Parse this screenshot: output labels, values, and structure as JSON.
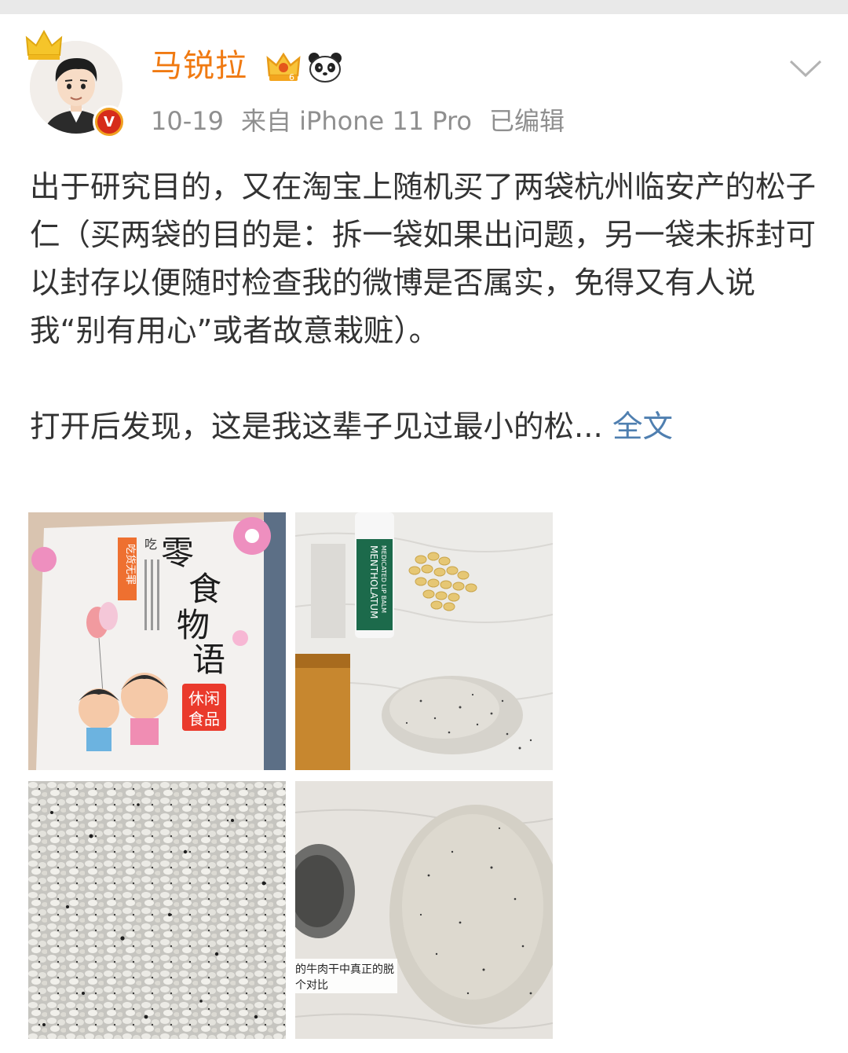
{
  "post": {
    "author": {
      "name": "马锐拉",
      "verified_mark": "V"
    },
    "time": "10-19",
    "source": "来自 iPhone 11 Pro",
    "edited": "已编辑",
    "text_paragraph_1": "出于研究目的，又在淘宝上随机买了两袋杭州临安产的松子仁（买两袋的目的是：拆一袋如果出问题，另一袋未拆封可以封存以便随时检查我的微博是否属实，免得又有人说我“别有用心”或者故意栽赃）。",
    "text_paragraph_2": "打开后发现，这是我这辈子见过最小的松...",
    "more_link": "全文",
    "images": [
      {
        "kind": "snack-bag",
        "title_chars": [
          "零",
          "食",
          "物",
          "语"
        ],
        "side_label": "吃货无罪",
        "top_label": "吃",
        "badge_line1": "休闲",
        "badge_line2": "食品"
      },
      {
        "kind": "lipbalm-and-nuts",
        "lipbalm_line1": "MENTHOLATUM",
        "lipbalm_line2": "MEDICATED LIP BALM"
      },
      {
        "kind": "closeup-grains"
      },
      {
        "kind": "comparison",
        "caption_line1": "的牛肉干中真正的脱",
        "caption_line2": "个对比"
      }
    ]
  },
  "icons": {
    "crown": "crown-icon",
    "member": "member-crown-icon",
    "panda": "panda-icon",
    "chevron": "chevron-down-icon"
  },
  "colors": {
    "username": "#f07a12",
    "link": "#4f7fb0",
    "meta": "#8f8f8f",
    "body_text": "#333333"
  }
}
